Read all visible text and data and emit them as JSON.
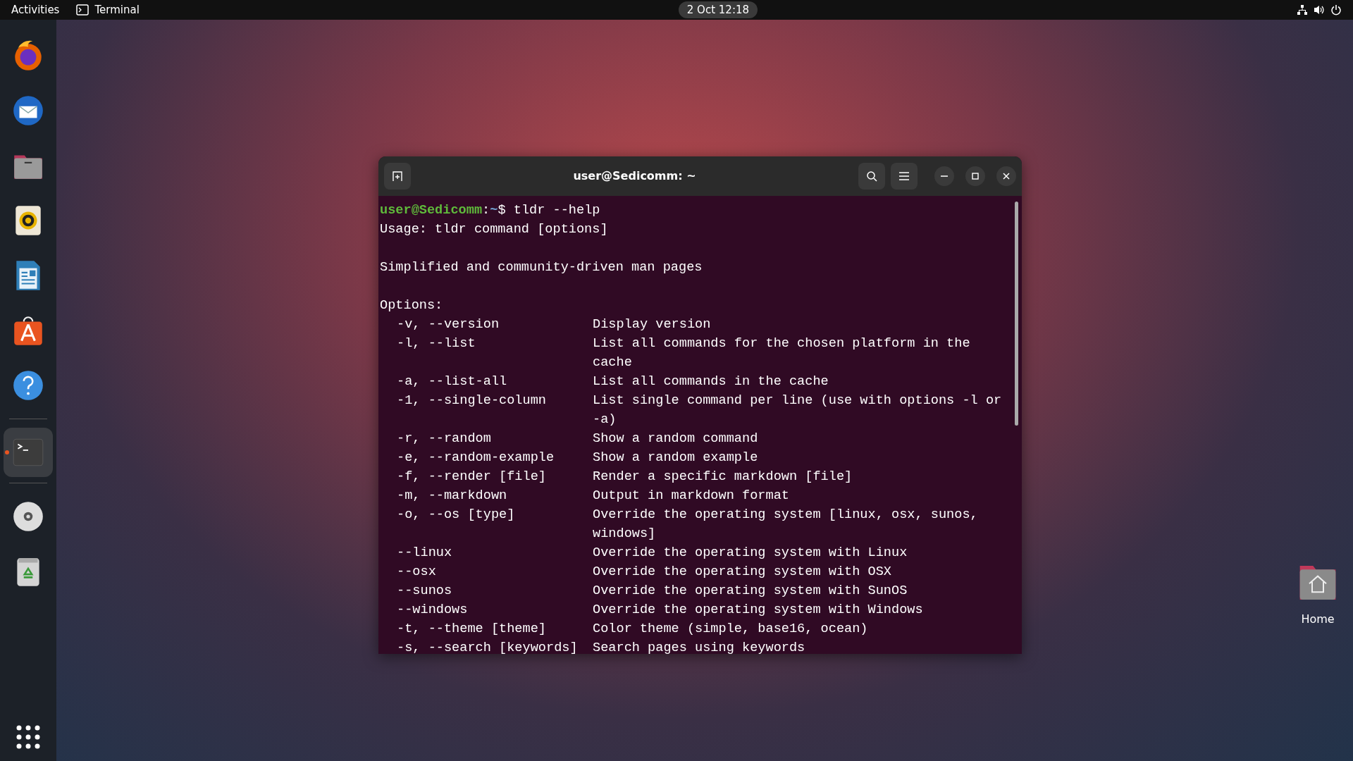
{
  "top_bar": {
    "activities": "Activities",
    "app_menu": "Terminal",
    "clock": "2 Oct  12:18"
  },
  "dock": [
    {
      "kind": "browser",
      "running": false
    },
    {
      "kind": "mail",
      "running": false
    },
    {
      "kind": "files",
      "running": false
    },
    {
      "kind": "speaker",
      "running": false
    },
    {
      "kind": "document",
      "running": false
    },
    {
      "kind": "store",
      "running": false
    },
    {
      "kind": "help",
      "running": false
    },
    {
      "kind": "terminal",
      "running": true
    },
    {
      "kind": "disc",
      "running": false
    },
    {
      "kind": "trash",
      "running": false
    }
  ],
  "desktop_icons": [
    {
      "label": "Home"
    }
  ],
  "terminal": {
    "title": "user@Sedicomm: ~",
    "lines": [
      {
        "kind": "prompt",
        "user": "user@Sedicomm",
        "separator": ":",
        "path": "~",
        "symbol": "$",
        "command": "tldr --help"
      },
      {
        "kind": "text",
        "text": "Usage: tldr command [options]"
      },
      {
        "kind": "blank"
      },
      {
        "kind": "text",
        "text": "Simplified and community-driven man pages"
      },
      {
        "kind": "blank"
      },
      {
        "kind": "text",
        "text": "Options:"
      },
      {
        "kind": "option",
        "option": "-v, --version",
        "description": "Display version"
      },
      {
        "kind": "option",
        "option": "-l, --list",
        "description": "List all commands for the chosen platform in the"
      },
      {
        "kind": "continuation",
        "description": "cache"
      },
      {
        "kind": "option",
        "option": "-a, --list-all",
        "description": "List all commands in the cache"
      },
      {
        "kind": "option",
        "option": "-1, --single-column",
        "description": "List single command per line (use with options -l or"
      },
      {
        "kind": "continuation",
        "description": "-a)"
      },
      {
        "kind": "option",
        "option": "-r, --random",
        "description": "Show a random command"
      },
      {
        "kind": "option",
        "option": "-e, --random-example",
        "description": "Show a random example"
      },
      {
        "kind": "option",
        "option": "-f, --render [file]",
        "description": "Render a specific markdown [file]"
      },
      {
        "kind": "option",
        "option": "-m, --markdown",
        "description": "Output in markdown format"
      },
      {
        "kind": "option",
        "option": "-o, --os [type]",
        "description": "Override the operating system [linux, osx, sunos,"
      },
      {
        "kind": "continuation",
        "description": "windows]"
      },
      {
        "kind": "option",
        "option": "--linux",
        "description": "Override the operating system with Linux"
      },
      {
        "kind": "option",
        "option": "--osx",
        "description": "Override the operating system with OSX"
      },
      {
        "kind": "option",
        "option": "--sunos",
        "description": "Override the operating system with SunOS"
      },
      {
        "kind": "option",
        "option": "--windows",
        "description": "Override the operating system with Windows"
      },
      {
        "kind": "option",
        "option": "-t, --theme [theme]",
        "description": "Color theme (simple, base16, ocean)"
      },
      {
        "kind": "option",
        "option": "-s, --search [keywords]",
        "description": "Search pages using keywords"
      }
    ]
  }
}
